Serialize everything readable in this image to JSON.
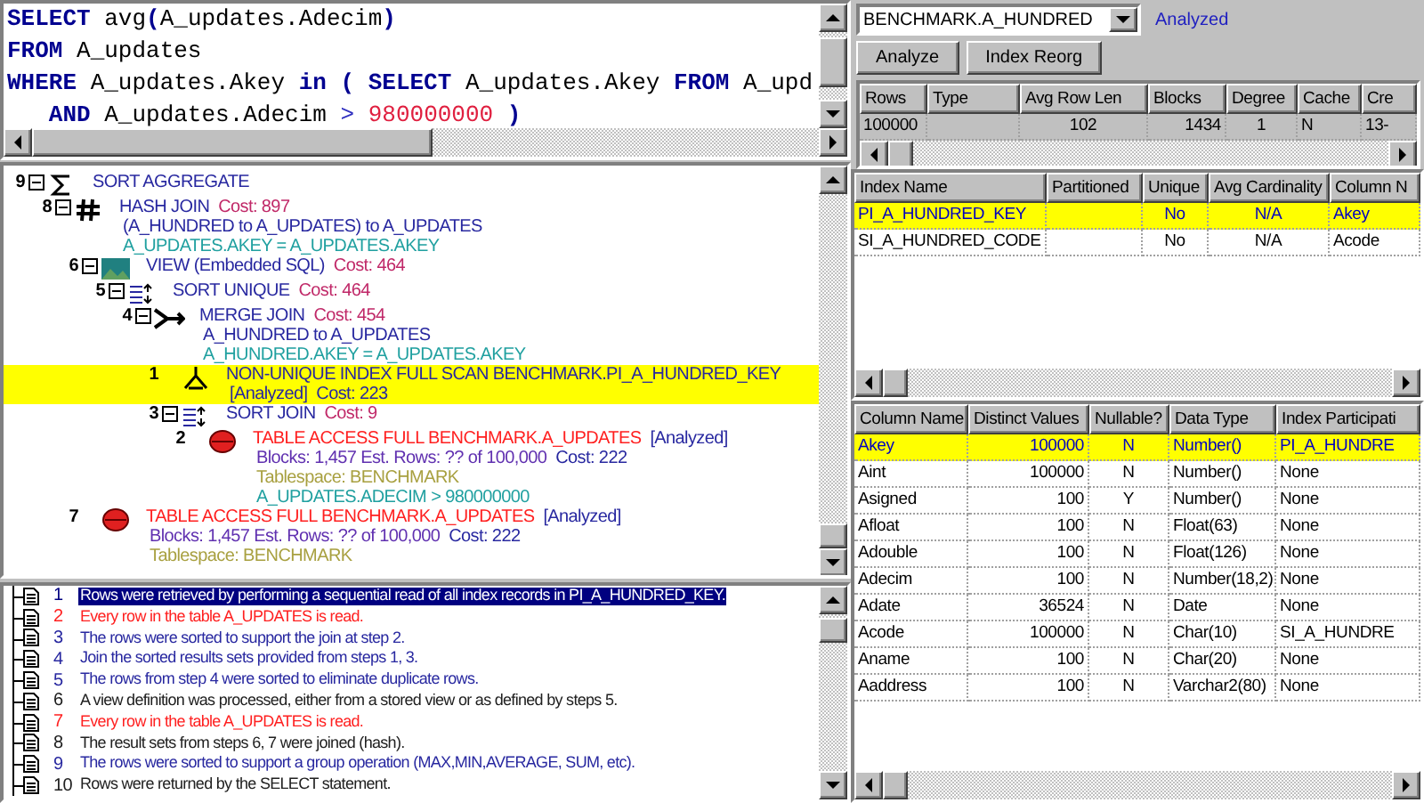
{
  "sql_editor": {
    "lines": [
      [
        {
          "text": "SELECT",
          "kind": "keyword"
        },
        {
          "text": " avg",
          "kind": "plain"
        },
        {
          "text": "(",
          "kind": "keyword"
        },
        {
          "text": "A_updates.Adecim",
          "kind": "plain"
        },
        {
          "text": ")",
          "kind": "keyword"
        }
      ],
      [
        {
          "text": "FROM",
          "kind": "keyword"
        },
        {
          "text": " A_updates",
          "kind": "plain"
        }
      ],
      [
        {
          "text": "WHERE",
          "kind": "keyword"
        },
        {
          "text": " A_updates.Akey ",
          "kind": "plain"
        },
        {
          "text": "in ( SELECT",
          "kind": "keyword"
        },
        {
          "text": " A_updates.Akey ",
          "kind": "plain"
        },
        {
          "text": "FROM",
          "kind": "keyword"
        },
        {
          "text": " A_upd",
          "kind": "plain"
        }
      ],
      [
        {
          "text": "   AND",
          "kind": "keyword"
        },
        {
          "text": " A_updates.Adecim ",
          "kind": "plain"
        },
        {
          "text": ">",
          "kind": "operator"
        },
        {
          "text": " 980000000",
          "kind": "number"
        },
        {
          "text": " )",
          "kind": "keyword"
        }
      ]
    ]
  },
  "plan": {
    "steps": [
      {
        "step": "9",
        "kind": "aggregate",
        "selected": false,
        "lines": [
          [
            {
              "text": "SORT AGGREGATE",
              "kind": "op"
            }
          ]
        ],
        "children": [
          {
            "step": "8",
            "kind": "hash",
            "selected": false,
            "lines": [
              [
                {
                  "text": "HASH JOIN",
                  "kind": "op"
                },
                {
                  "text": "  Cost: 897",
                  "kind": "cost"
                }
              ],
              [
                {
                  "text": "(A_HUNDRED to A_UPDATES) to A_UPDATES",
                  "kind": "op"
                }
              ],
              [
                {
                  "text": "A_UPDATES.AKEY = A_UPDATES.AKEY",
                  "kind": "predicate"
                }
              ]
            ],
            "children": [
              {
                "step": "6",
                "kind": "view",
                "selected": false,
                "lines": [
                  [
                    {
                      "text": "VIEW (Embedded SQL)",
                      "kind": "op"
                    },
                    {
                      "text": "  Cost: 464",
                      "kind": "cost"
                    }
                  ]
                ],
                "children": [
                  {
                    "step": "5",
                    "kind": "sort",
                    "selected": false,
                    "lines": [
                      [
                        {
                          "text": "SORT UNIQUE",
                          "kind": "op"
                        },
                        {
                          "text": "  Cost: 464",
                          "kind": "cost"
                        }
                      ]
                    ],
                    "children": [
                      {
                        "step": "4",
                        "kind": "merge",
                        "selected": false,
                        "lines": [
                          [
                            {
                              "text": "MERGE JOIN",
                              "kind": "op"
                            },
                            {
                              "text": "  Cost: 454",
                              "kind": "cost"
                            }
                          ],
                          [
                            {
                              "text": "A_HUNDRED to A_UPDATES",
                              "kind": "op"
                            }
                          ],
                          [
                            {
                              "text": "A_HUNDRED.AKEY = A_UPDATES.AKEY",
                              "kind": "predicate"
                            }
                          ]
                        ],
                        "children": [
                          {
                            "step": "1",
                            "kind": "index",
                            "selected": true,
                            "lines": [
                              [
                                {
                                  "text": "NON-UNIQUE INDEX FULL SCAN BENCHMARK.PI_A_HUNDRED_KEY",
                                  "kind": "op"
                                }
                              ],
                              [
                                {
                                  "text": "[Analyzed]",
                                  "kind": "op"
                                },
                                {
                                  "text": "  Cost: 223",
                                  "kind": "op"
                                }
                              ]
                            ]
                          },
                          {
                            "step": "3",
                            "kind": "sort",
                            "selected": false,
                            "lines": [
                              [
                                {
                                  "text": "SORT JOIN",
                                  "kind": "op"
                                },
                                {
                                  "text": "  Cost: 9",
                                  "kind": "cost"
                                }
                              ]
                            ],
                            "children": [
                              {
                                "step": "2",
                                "kind": "table",
                                "selected": false,
                                "lines": [
                                  [
                                    {
                                      "text": "TABLE ACCESS FULL BENCHMARK.A_UPDATES",
                                      "kind": "table"
                                    },
                                    {
                                      "text": "  [Analyzed]",
                                      "kind": "op"
                                    }
                                  ],
                                  [
                                    {
                                      "text": "Blocks: 1,457 Est. Rows: ?? of 100,000",
                                      "kind": "stats"
                                    },
                                    {
                                      "text": "  Cost: 222",
                                      "kind": "op"
                                    }
                                  ],
                                  [
                                    {
                                      "text": "Tablespace: BENCHMARK",
                                      "kind": "tablespace"
                                    }
                                  ],
                                  [
                                    {
                                      "text": "A_UPDATES.ADECIM > 980000000",
                                      "kind": "predicate"
                                    }
                                  ]
                                ]
                              }
                            ]
                          }
                        ]
                      }
                    ]
                  }
                ]
              },
              {
                "step": "7",
                "kind": "table",
                "selected": false,
                "lines": [
                  [
                    {
                      "text": "TABLE ACCESS FULL BENCHMARK.A_UPDATES",
                      "kind": "table"
                    },
                    {
                      "text": "  [Analyzed]",
                      "kind": "op"
                    }
                  ],
                  [
                    {
                      "text": "Blocks: 1,457 Est. Rows: ?? of 100,000",
                      "kind": "stats"
                    },
                    {
                      "text": "  Cost: 222",
                      "kind": "op"
                    }
                  ],
                  [
                    {
                      "text": "Tablespace: BENCHMARK",
                      "kind": "tablespace"
                    }
                  ]
                ]
              }
            ]
          }
        ]
      }
    ]
  },
  "explanations": [
    {
      "step": "1",
      "text": "Rows were retrieved by performing a sequential read of all index records in PI_A_HUNDRED_KEY.",
      "color": "#000080",
      "selected": true
    },
    {
      "step": "2",
      "text": "Every row in the table A_UPDATES is read.",
      "color": "#ff2020",
      "selected": false
    },
    {
      "step": "3",
      "text": "The rows were sorted to support the join at step 2.",
      "color": "#2828a0",
      "selected": false
    },
    {
      "step": "4",
      "text": "Join the sorted results sets provided from steps 1, 3.",
      "color": "#2828a0",
      "selected": false
    },
    {
      "step": "5",
      "text": "The rows from step 4 were sorted to eliminate duplicate rows.",
      "color": "#2828a0",
      "selected": false
    },
    {
      "step": "6",
      "text": "A view definition was processed, either from a stored view or as defined by steps 5.",
      "color": "#202020",
      "selected": false
    },
    {
      "step": "7",
      "text": "Every row in the table A_UPDATES is read.",
      "color": "#ff2020",
      "selected": false
    },
    {
      "step": "8",
      "text": "The result sets from steps 6, 7 were joined (hash).",
      "color": "#202020",
      "selected": false
    },
    {
      "step": "9",
      "text": "The rows were sorted to support a group operation (MAX,MIN,AVERAGE, SUM, etc).",
      "color": "#2828a0",
      "selected": false
    },
    {
      "step": "10",
      "text": "Rows were returned by the SELECT statement.",
      "color": "#202020",
      "selected": false
    }
  ],
  "object_panel": {
    "object": "BENCHMARK.A_HUNDRED",
    "status": "Analyzed",
    "buttons": [
      "Analyze",
      "Index Reorg"
    ],
    "stats_table": {
      "columns": [
        "Rows",
        "Type",
        "Avg Row Len",
        "Blocks",
        "Degree",
        "Cache",
        "Cre"
      ],
      "rows": [
        {
          "cells": [
            "100000",
            null,
            "102",
            "1434",
            "1",
            "N",
            "13-"
          ]
        }
      ]
    }
  },
  "index_table": {
    "columns": [
      "Index Name",
      "Partitioned",
      "Unique",
      "Avg Cardinality",
      "Column N"
    ],
    "rows": [
      {
        "cells": [
          "PI_A_HUNDRED_KEY",
          null,
          "No",
          "N/A",
          "Akey"
        ],
        "selected": true
      },
      {
        "cells": [
          "SI_A_HUNDRED_CODE",
          null,
          "No",
          "N/A",
          "Acode"
        ],
        "selected": false
      }
    ]
  },
  "column_table": {
    "columns": [
      "Column Name",
      "Distinct Values",
      "Nullable?",
      "Data Type",
      "Index Participati"
    ],
    "rows": [
      {
        "cells": [
          "Akey",
          "100000",
          "N",
          "Number()",
          "PI_A_HUNDRE"
        ],
        "selected": true
      },
      {
        "cells": [
          "Aint",
          "100000",
          "N",
          "Number()",
          "None"
        ],
        "selected": false
      },
      {
        "cells": [
          "Asigned",
          "100",
          "Y",
          "Number()",
          "None"
        ],
        "selected": false
      },
      {
        "cells": [
          "Afloat",
          "100",
          "N",
          "Float(63)",
          "None"
        ],
        "selected": false
      },
      {
        "cells": [
          "Adouble",
          "100",
          "N",
          "Float(126)",
          "None"
        ],
        "selected": false
      },
      {
        "cells": [
          "Adecim",
          "100",
          "N",
          "Number(18,2)",
          "None"
        ],
        "selected": false
      },
      {
        "cells": [
          "Adate",
          "36524",
          "N",
          "Date",
          "None"
        ],
        "selected": false
      },
      {
        "cells": [
          "Acode",
          "100000",
          "N",
          "Char(10)",
          "SI_A_HUNDRE"
        ],
        "selected": false
      },
      {
        "cells": [
          "Aname",
          "100",
          "N",
          "Char(20)",
          "None"
        ],
        "selected": false
      },
      {
        "cells": [
          "Aaddress",
          "100",
          "N",
          "Varchar2(80)",
          "None"
        ],
        "selected": false
      }
    ]
  }
}
